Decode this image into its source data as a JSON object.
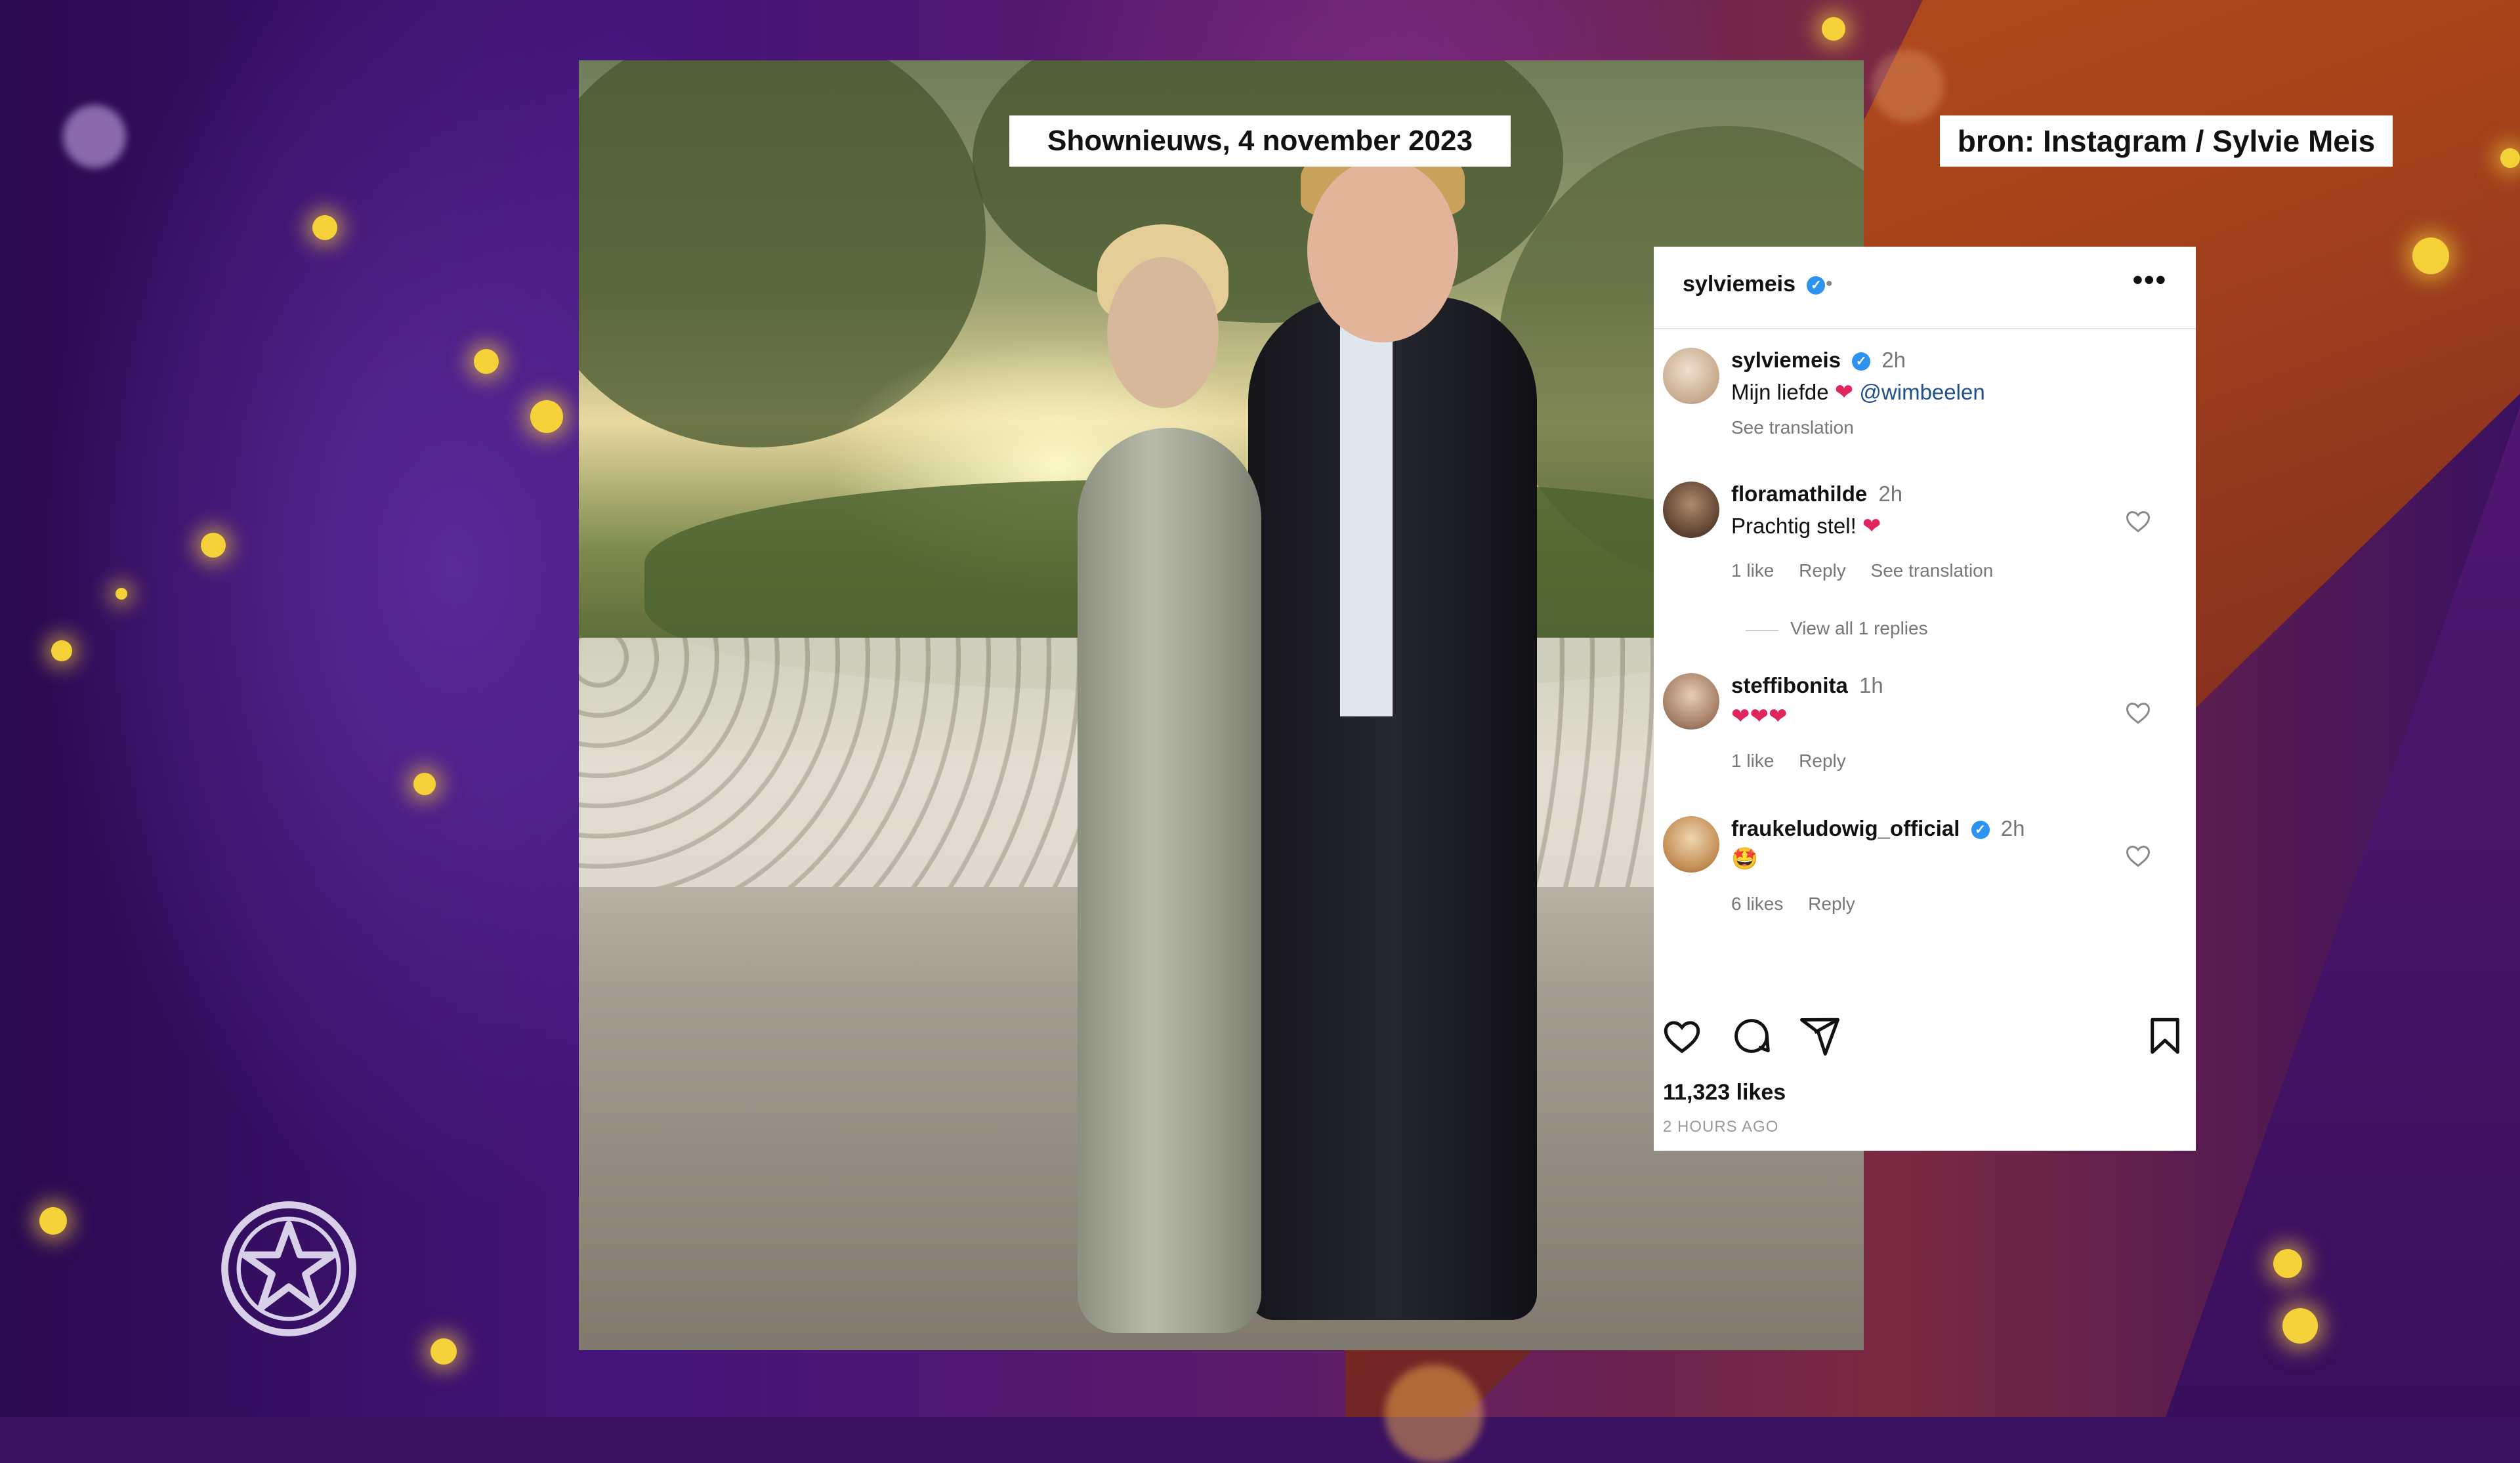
{
  "overlay": {
    "date_label": "Shownieuws, 4 november 2023",
    "source_label": "bron: Instagram / Sylvie Meis"
  },
  "post": {
    "username": "sylviemeis",
    "header_separator": "•",
    "more_label": "•••",
    "likes": "11,323 likes",
    "time_ago": "2 HOURS AGO"
  },
  "caption": {
    "username": "sylviemeis",
    "time": "2h",
    "text": "Mijn liefde",
    "mention": "@wimbeelen",
    "see_translation": "See translation"
  },
  "comments": [
    {
      "username": "floramathilde",
      "time": "2h",
      "text": "Prachtig stel!",
      "emoji": "❤",
      "likes": "1 like",
      "reply": "Reply",
      "see_translation": "See translation",
      "view_replies": "View all 1 replies"
    },
    {
      "username": "steffibonita",
      "time": "1h",
      "text": "",
      "emoji": "❤❤❤",
      "likes": "1 like",
      "reply": "Reply"
    },
    {
      "username": "fraukeludowig_official",
      "time": "2h",
      "text": "",
      "emoji": "🤩",
      "likes": "6 likes",
      "reply": "Reply"
    }
  ],
  "icons": {
    "like": "heart-icon",
    "comment": "comment-icon",
    "share": "share-icon",
    "save": "bookmark-icon",
    "verified": "verified-badge-icon",
    "logo": "star-logo-icon"
  },
  "colors": {
    "verified_blue": "#2d92f0",
    "heart_red": "#e0245e",
    "accent_yellow": "#f5d23a",
    "background_purple": "#3a1060",
    "background_orange": "#c4561f"
  }
}
